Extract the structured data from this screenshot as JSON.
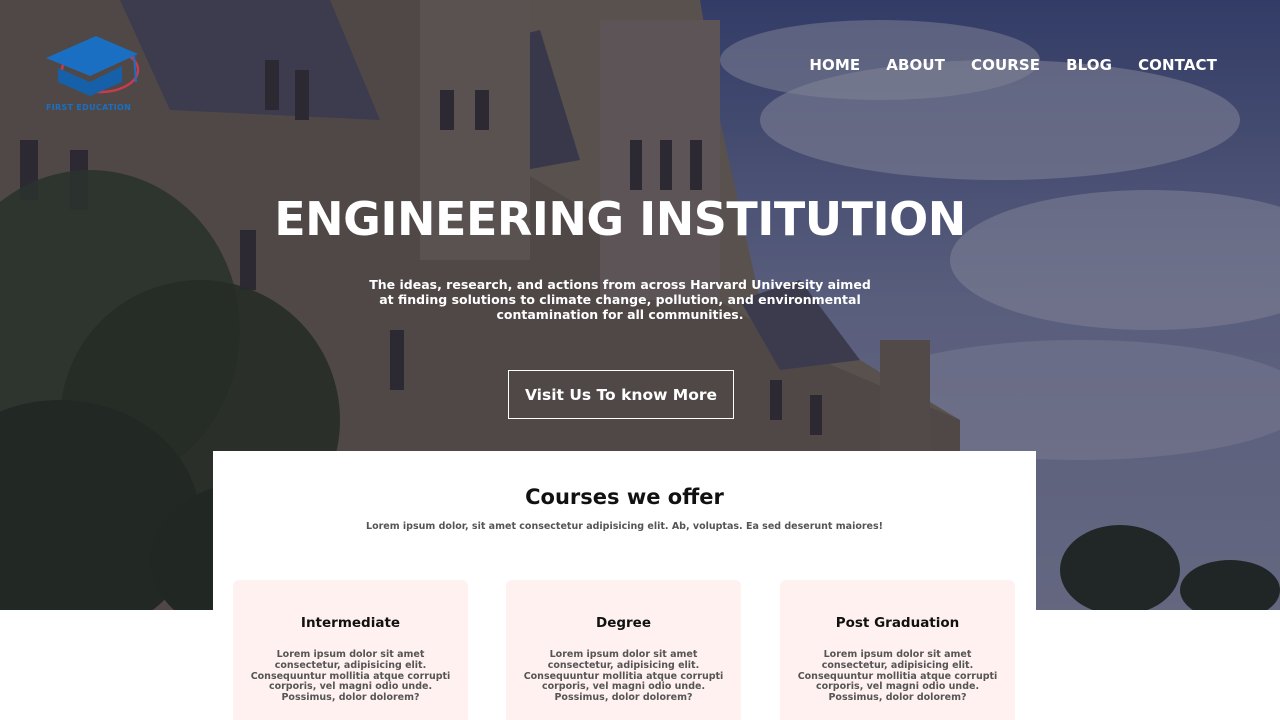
{
  "brand": {
    "logo_text": "FIRST EDUCATION",
    "logo_color": "#1a6fc2"
  },
  "nav": {
    "items": [
      "HOME",
      "ABOUT",
      "COURSE",
      "BLOG",
      "CONTACT"
    ]
  },
  "hero": {
    "title": "ENGINEERING INSTITUTION",
    "subtitle": "The ideas, research, and actions from across Harvard University aimed at finding solutions to climate change, pollution, and environmental contamination for all communities.",
    "button_label": "Visit Us To know More"
  },
  "courses": {
    "title": "Courses we offer",
    "subtitle": "Lorem ipsum dolor, sit amet consectetur adipisicing elit. Ab, voluptas. Ea sed deserunt maiores!",
    "cards": [
      {
        "title": "Intermediate",
        "text": "Lorem ipsum dolor sit amet consectetur, adipisicing elit. Consequuntur mollitia atque corrupti corporis, vel magni odio unde. Possimus, dolor dolorem?"
      },
      {
        "title": "Degree",
        "text": "Lorem ipsum dolor sit amet consectetur, adipisicing elit. Consequuntur mollitia atque corrupti corporis, vel magni odio unde. Possimus, dolor dolorem?"
      },
      {
        "title": "Post Graduation",
        "text": "Lorem ipsum dolor sit amet consectetur, adipisicing elit. Consequuntur mollitia atque corrupti corporis, vel magni odio unde. Possimus, dolor dolorem?"
      }
    ]
  },
  "colors": {
    "card_background": "#fff1f0",
    "hero_overlay": "#141232"
  }
}
